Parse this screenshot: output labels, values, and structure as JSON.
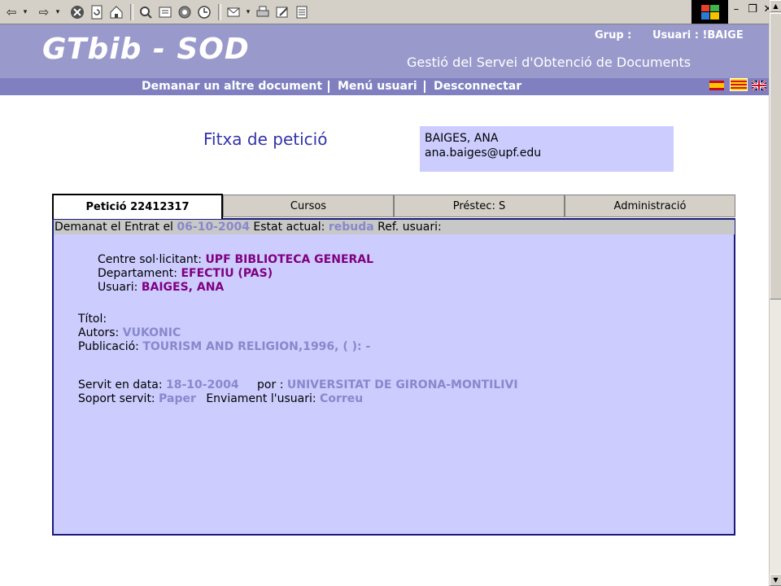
{
  "browser": {
    "buttons": [
      "back-icon",
      "forward-icon",
      "stop-icon",
      "refresh-icon",
      "home-icon",
      "search-icon",
      "favorites-icon",
      "history-icon",
      "media-icon",
      "mail-icon",
      "print-icon",
      "edit-icon",
      "discuss-icon"
    ]
  },
  "header": {
    "logo": "GTbib - SOD",
    "grup_label": "Grup :",
    "usuari_label": "Usuari : !BAIGE",
    "subtitle": "Gestió del Servei d'Obtenció de Documents"
  },
  "nav": {
    "link1": "Demanar un altre document",
    "link2": "Menú usuari",
    "link3": "Desconnectar"
  },
  "page": {
    "title": "Fitxa de petició",
    "user_name": "BAIGES, ANA",
    "user_email": "ana.baiges@upf.edu"
  },
  "tabs": [
    "Petició 22412317",
    "Cursos",
    "Préstec: S",
    "Administració"
  ],
  "status": {
    "demanat": "Demanat el Entrat el",
    "date": "06-10-2004",
    "estat_label": "Estat actual:",
    "estat_value": "rebuda",
    "ref_label": "Ref. usuari:"
  },
  "request": {
    "centre_label": "Centre sol·licitant:",
    "centre_value": "UPF BIBLIOTECA GENERAL",
    "dept_label": "Departament:",
    "dept_value": "EFECTIU (PAS)",
    "usuari_label": "Usuari:",
    "usuari_value": "BAIGES, ANA",
    "titol_label": "Títol:",
    "autors_label": "Autors:",
    "autors_value": "VUKONIC",
    "publicacio_label": "Publicació:",
    "publicacio_value": "TOURISM AND RELIGION,1996, ( ): -",
    "servit_label": "Servit en data:",
    "servit_value": "18-10-2004",
    "por_label": "por :",
    "por_value": "UNIVERSITAT DE GIRONA-MONTILIVI",
    "soport_label": "Soport servit:",
    "soport_value": "Paper",
    "enviament_label": "Enviament l'usuari:",
    "enviament_value": "Correu"
  },
  "colors": {
    "banner": "#9999cc",
    "navbar": "#8080c0",
    "panel": "#ccccff",
    "value_grey": "#8888cc",
    "value_purple": "#800080",
    "title": "#3333aa"
  }
}
